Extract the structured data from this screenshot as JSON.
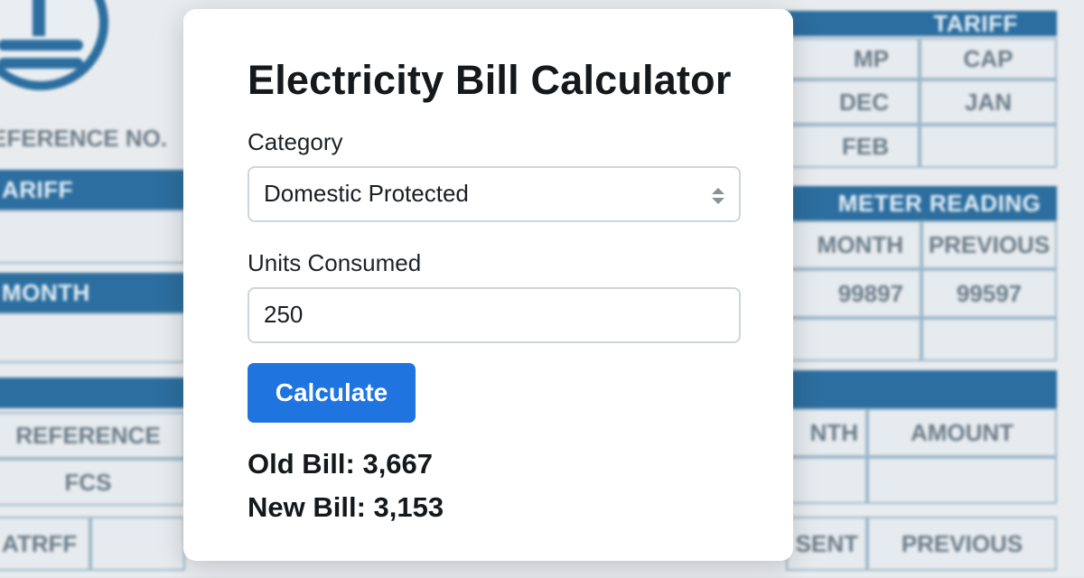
{
  "calculator": {
    "title": "Electricity Bill Calculator",
    "category_label": "Category",
    "category_value": "Domestic Protected",
    "units_label": "Units Consumed",
    "units_value": "250",
    "calculate_label": "Calculate",
    "old_bill_label": "Old Bill:",
    "old_bill_value": "3,667",
    "new_bill_label": "New Bill:",
    "new_bill_value": "3,153",
    "accent_color": "#1f74e0"
  },
  "background": {
    "left": {
      "reference_no": "EFERENCE NO.",
      "tariff_bar": "ARIFF",
      "month_bar": "MONTH",
      "reference": "REFERENCE",
      "fcs": "FCS",
      "atrff": "ATRFF"
    },
    "right": {
      "tariff_bar": "TARIFF",
      "tariff_cells": [
        "MP",
        "CAP",
        "DEC",
        "JAN",
        "FEB",
        ""
      ],
      "meter_bar": "METER READING",
      "meter_headers": [
        "MONTH",
        "PREVIOUS"
      ],
      "meter_values": [
        "99897",
        "99597"
      ],
      "nth": "NTH",
      "amount": "AMOUNT",
      "sent": "SENT",
      "previous": "PREVIOUS"
    },
    "brand_color": "#2c6e9f"
  }
}
